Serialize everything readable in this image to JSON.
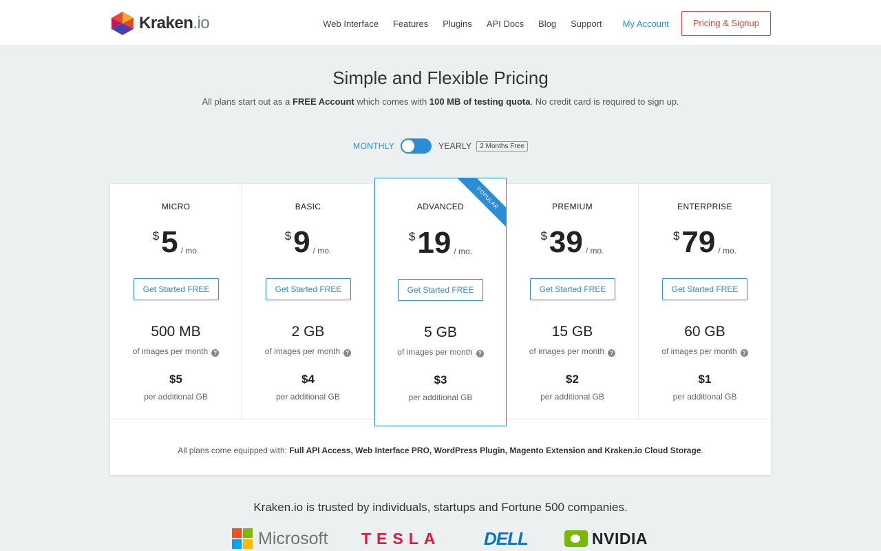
{
  "header": {
    "logo": {
      "brand": "Kraken",
      "tld": ".io"
    },
    "nav": [
      "Web Interface",
      "Features",
      "Plugins",
      "API Docs",
      "Blog",
      "Support"
    ],
    "my_account": "My Account",
    "signup": "Pricing & Signup"
  },
  "hero": {
    "title": "Simple and Flexible Pricing",
    "sub_1": "All plans start out as a ",
    "sub_bold_1": "FREE Account",
    "sub_2": " which comes with ",
    "sub_bold_2": "100 MB of testing quota",
    "sub_3": ". No credit card is required to sign up."
  },
  "billing": {
    "monthly": "MONTHLY",
    "yearly": "YEARLY",
    "badge": "2 Months Free",
    "selected": "MONTHLY"
  },
  "plans": [
    {
      "name": "MICRO",
      "currency": "$",
      "price": "5",
      "per": "/ mo.",
      "cta": "Get Started FREE",
      "quota": "500 MB",
      "quota_label": "of images per month",
      "extra": "$5",
      "extra_label": "per additional GB"
    },
    {
      "name": "BASIC",
      "currency": "$",
      "price": "9",
      "per": "/ mo.",
      "cta": "Get Started FREE",
      "quota": "2 GB",
      "quota_label": "of images per month",
      "extra": "$4",
      "extra_label": "per additional GB"
    },
    {
      "name": "ADVANCED",
      "currency": "$",
      "price": "19",
      "per": "/ mo.",
      "cta": "Get Started FREE",
      "quota": "5 GB",
      "quota_label": "of images per month",
      "extra": "$3",
      "extra_label": "per additional GB",
      "ribbon": "POPULAR"
    },
    {
      "name": "PREMIUM",
      "currency": "$",
      "price": "39",
      "per": "/ mo.",
      "cta": "Get Started FREE",
      "quota": "15 GB",
      "quota_label": "of images per month",
      "extra": "$2",
      "extra_label": "per additional GB"
    },
    {
      "name": "ENTERPRISE",
      "currency": "$",
      "price": "79",
      "per": "/ mo.",
      "cta": "Get Started FREE",
      "quota": "60 GB",
      "quota_label": "of images per month",
      "extra": "$1",
      "extra_label": "per additional GB"
    }
  ],
  "help_glyph": "?",
  "equipped": {
    "prefix": "All plans come equipped with: ",
    "features": "Full API Access, Web Interface PRO, WordPress Plugin, Magento Extension and Kraken.io Cloud Storage",
    "suffix": "."
  },
  "trusted": "Kraken.io is trusted by individuals, startups and Fortune 500 companies.",
  "clients": {
    "microsoft": "Microsoft",
    "tesla": "TESLA",
    "dell": "DELL",
    "nvidia": "NVIDIA"
  },
  "colors": {
    "accent": "#2d8cd7",
    "signup": "#e0463c",
    "background": "#ecf0f1"
  }
}
